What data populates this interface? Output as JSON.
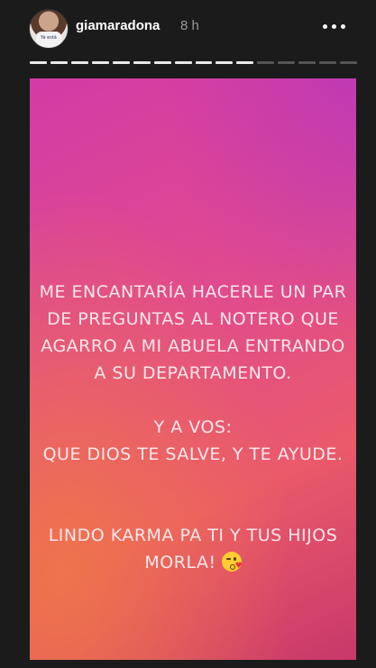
{
  "header": {
    "username": "giamaradona",
    "time": "8 h",
    "avatar_shirt_text": "Ya está"
  },
  "progress": {
    "total_segments": 16,
    "completed_segments": 11
  },
  "story": {
    "paragraph1": [
      "ME ENCANTARÍA HACERLE UN PAR",
      "DE PREGUNTAS AL NOTERO QUE",
      "AGARRO A MI ABUELA ENTRANDO",
      "A SU DEPARTAMENTO."
    ],
    "paragraph2": [
      "Y A VOS:",
      "QUE DIOS TE SALVE, Y TE AYUDE."
    ],
    "paragraph3": [
      "LINDO KARMA PA TI Y TUS HIJOS",
      "MORLA!"
    ],
    "emoji": "face-blowing-kiss-icon",
    "colors": {
      "gradient_start": "#d33ba6",
      "gradient_mid": "#ea5a6a",
      "warm_corner": "#f07846",
      "text": "#fbe7ec"
    }
  }
}
